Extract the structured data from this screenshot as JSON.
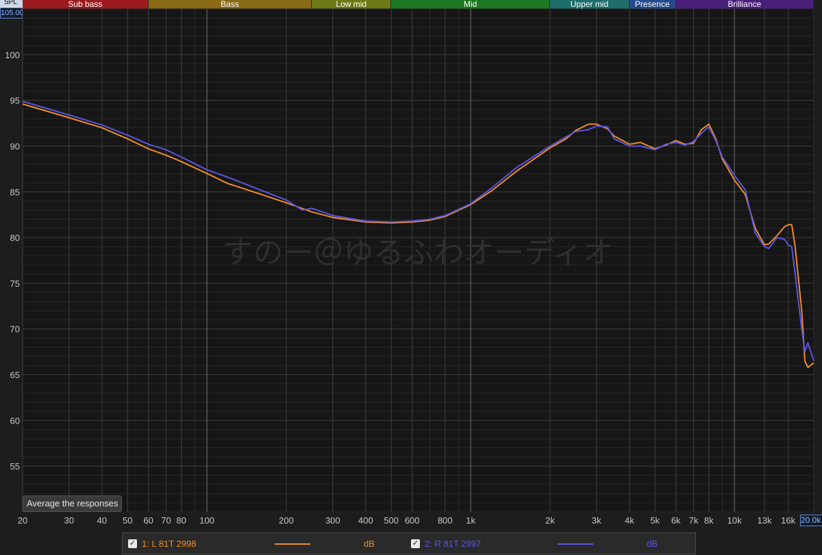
{
  "bands": [
    {
      "label": "Sub bass",
      "from": 20,
      "to": 60,
      "color": "#9c1b20"
    },
    {
      "label": "Bass",
      "from": 60,
      "to": 250,
      "color": "#8b6a15"
    },
    {
      "label": "Low mid",
      "from": 250,
      "to": 500,
      "color": "#6c7a15"
    },
    {
      "label": "Mid",
      "from": 500,
      "to": 2000,
      "color": "#1d7a22"
    },
    {
      "label": "Upper mid",
      "from": 2000,
      "to": 4000,
      "color": "#1d6e6a"
    },
    {
      "label": "Presence",
      "from": 4000,
      "to": 6000,
      "color": "#264a8a"
    },
    {
      "label": "Brilliance",
      "from": 6000,
      "to": 20000,
      "color": "#4a1f7a"
    }
  ],
  "y_axis_title": "SPL",
  "y_max_box": "105.00",
  "x_max_box": "20.0k",
  "watermark": "すのー＠ゆるふわオーディオ",
  "average_button": "Average the responses",
  "legend": [
    {
      "label": "1: L 81T 2998",
      "unit": "dB",
      "color": "#f08c28",
      "checked": "✓"
    },
    {
      "label": "2: R 81T 2997",
      "unit": "dB",
      "color": "#5a55e0",
      "checked": "✓"
    }
  ],
  "chart_data": {
    "type": "line",
    "x_scale": "log",
    "xlim": [
      20,
      20000
    ],
    "ylim": [
      50,
      105
    ],
    "grid": true,
    "x_ticks": [
      {
        "v": 20,
        "t": "20"
      },
      {
        "v": 30,
        "t": "30"
      },
      {
        "v": 40,
        "t": "40"
      },
      {
        "v": 50,
        "t": "50"
      },
      {
        "v": 60,
        "t": "60"
      },
      {
        "v": 70,
        "t": "70"
      },
      {
        "v": 80,
        "t": "80"
      },
      {
        "v": 100,
        "t": "100"
      },
      {
        "v": 200,
        "t": "200"
      },
      {
        "v": 300,
        "t": "300"
      },
      {
        "v": 400,
        "t": "400"
      },
      {
        "v": 500,
        "t": "500"
      },
      {
        "v": 600,
        "t": "600"
      },
      {
        "v": 800,
        "t": "800"
      },
      {
        "v": 1000,
        "t": "1k"
      },
      {
        "v": 2000,
        "t": "2k"
      },
      {
        "v": 3000,
        "t": "3k"
      },
      {
        "v": 4000,
        "t": "4k"
      },
      {
        "v": 5000,
        "t": "5k"
      },
      {
        "v": 6000,
        "t": "6k"
      },
      {
        "v": 7000,
        "t": "7k"
      },
      {
        "v": 8000,
        "t": "8k"
      },
      {
        "v": 10000,
        "t": "10k"
      },
      {
        "v": 13000,
        "t": "13k"
      },
      {
        "v": 16000,
        "t": "16k"
      }
    ],
    "y_ticks": [
      55,
      60,
      65,
      70,
      75,
      80,
      85,
      90,
      95,
      100
    ],
    "series": [
      {
        "name": "1: L 81T 2998",
        "color": "#f08c28",
        "x": [
          20,
          30,
          40,
          50,
          60,
          70,
          80,
          100,
          120,
          150,
          200,
          250,
          300,
          400,
          500,
          600,
          700,
          800,
          1000,
          1200,
          1500,
          2000,
          2300,
          2500,
          2800,
          3000,
          3300,
          3500,
          4000,
          4400,
          5000,
          5500,
          6000,
          6500,
          7000,
          7500,
          8000,
          8500,
          9000,
          10000,
          11000,
          12000,
          13000,
          13500,
          14500,
          15500,
          16000,
          16500,
          17000,
          18000,
          18500,
          19000,
          20000
        ],
        "y": [
          94.6,
          93.1,
          92.0,
          90.8,
          89.7,
          89.0,
          88.3,
          87.0,
          85.9,
          85.0,
          83.8,
          82.8,
          82.2,
          81.7,
          81.6,
          81.7,
          81.9,
          82.3,
          83.6,
          85.1,
          87.3,
          89.8,
          90.8,
          91.7,
          92.4,
          92.4,
          91.9,
          91.1,
          90.2,
          90.4,
          89.7,
          90.1,
          90.6,
          90.2,
          90.3,
          91.8,
          92.4,
          90.8,
          88.6,
          86.3,
          84.7,
          81.0,
          79.2,
          79.3,
          80.2,
          81.2,
          81.4,
          81.4,
          79.0,
          72.0,
          66.5,
          65.8,
          66.3
        ]
      },
      {
        "name": "2: R 81T 2997",
        "color": "#5a55e0",
        "x": [
          20,
          30,
          40,
          50,
          60,
          70,
          80,
          100,
          120,
          150,
          200,
          230,
          250,
          300,
          400,
          500,
          600,
          700,
          800,
          1000,
          1200,
          1500,
          2000,
          2300,
          2500,
          2800,
          3000,
          3300,
          3500,
          4000,
          4400,
          5000,
          5500,
          6000,
          6500,
          7000,
          7500,
          8000,
          8500,
          9000,
          10000,
          11000,
          12000,
          13000,
          13500,
          14500,
          15500,
          16000,
          16500,
          17000,
          18000,
          18500,
          19000,
          20000
        ],
        "y": [
          94.9,
          93.4,
          92.3,
          91.2,
          90.2,
          89.6,
          88.8,
          87.4,
          86.6,
          85.5,
          84.1,
          83.0,
          83.2,
          82.4,
          81.8,
          81.7,
          81.8,
          82.0,
          82.4,
          83.7,
          85.4,
          87.7,
          90.0,
          91.0,
          91.6,
          91.8,
          92.2,
          92.1,
          90.8,
          90.0,
          90.0,
          89.6,
          90.2,
          90.4,
          90.1,
          90.5,
          91.4,
          92.1,
          90.6,
          88.8,
          86.8,
          85.2,
          80.5,
          79.0,
          78.8,
          80.0,
          79.8,
          79.2,
          79.0,
          76.0,
          70.0,
          67.5,
          68.5,
          66.5
        ]
      }
    ]
  }
}
